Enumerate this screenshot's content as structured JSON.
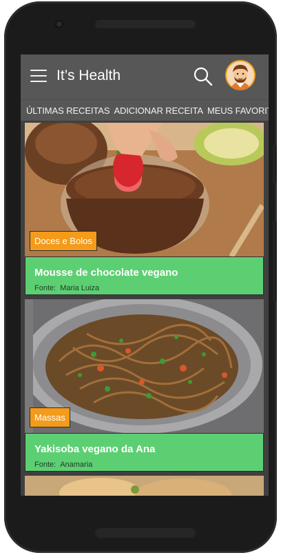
{
  "app": {
    "title": "It’s Health"
  },
  "tabs": [
    {
      "label": "ÚLTIMAS RECEITAS"
    },
    {
      "label": "ADICIONAR RECEITA"
    },
    {
      "label": "MEUS FAVORITOS"
    }
  ],
  "recipes": [
    {
      "category": "Doces e Bolos",
      "title": "Mousse de chocolate vegano",
      "source_label": "Fonte:",
      "source": "Maria Luiza"
    },
    {
      "category": "Massas",
      "title": "Yakisoba vegano da Ana",
      "source_label": "Fonte:",
      "source": "Anamaria"
    }
  ],
  "colors": {
    "appbar": "#575757",
    "card_info": "#5dcf73",
    "badge": "#f39b1a",
    "avatar_ring": "#f0a020"
  },
  "icons": [
    "menu-icon",
    "search-icon",
    "avatar"
  ]
}
